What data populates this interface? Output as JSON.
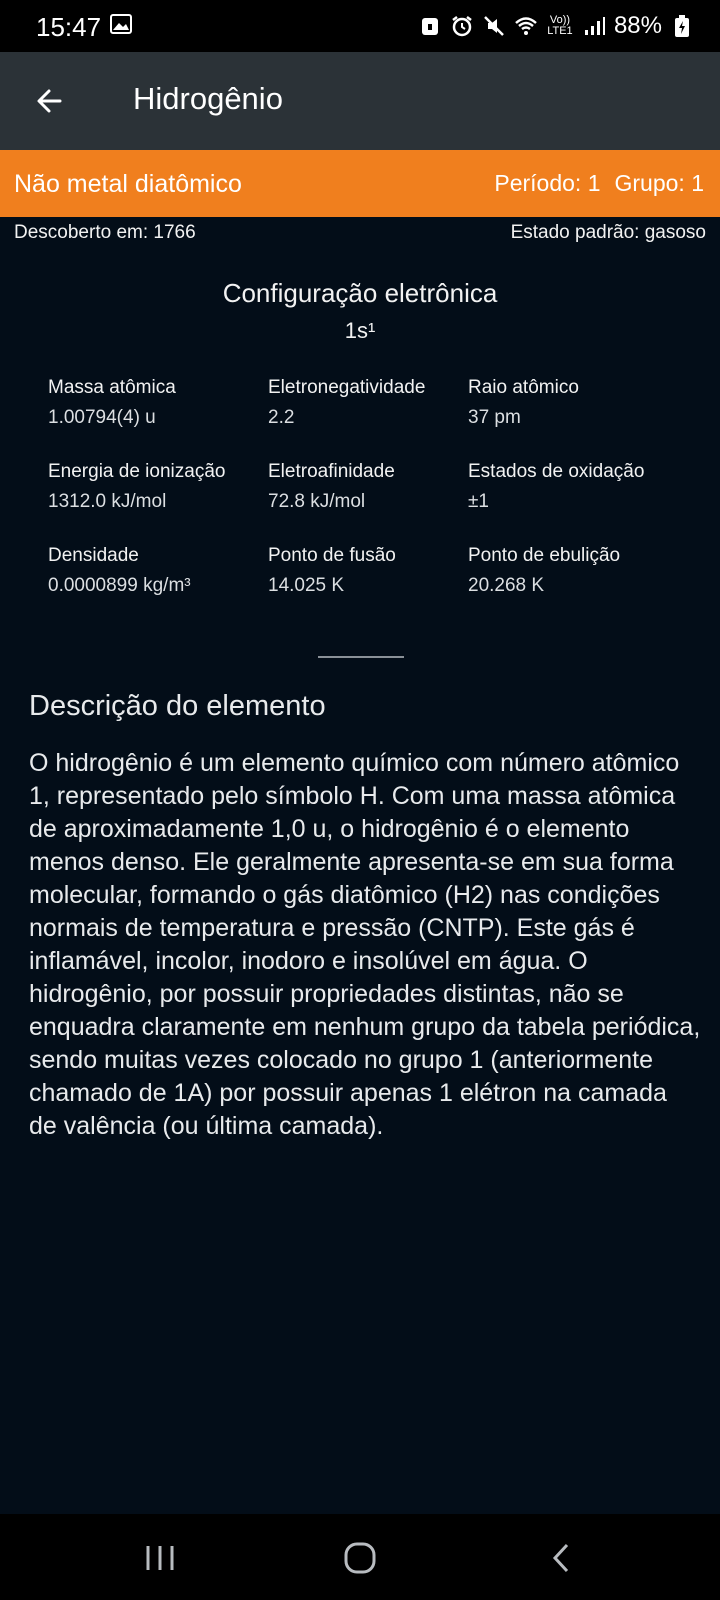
{
  "status_bar": {
    "time": "15:47",
    "network_label_top": "Vo))",
    "network_label_bottom": "LTE1",
    "battery": "88%"
  },
  "app_bar": {
    "title": "Hidrogênio",
    "back_icon": "arrow-left-icon"
  },
  "category_bar": {
    "name": "Não metal diatômico",
    "period": "Período: 1",
    "group": "Grupo: 1",
    "color": "#f07f1e"
  },
  "meta": {
    "discovered": "Descoberto em: 1766",
    "standard_state": "Estado padrão: gasoso"
  },
  "configuration": {
    "title": "Configuração eletrônica",
    "value": "1s¹"
  },
  "properties": [
    {
      "label": "Massa atômica",
      "value": "1.00794(4) u"
    },
    {
      "label": "Eletronegatividade",
      "value": "2.2"
    },
    {
      "label": "Raio atômico",
      "value": "37 pm"
    },
    {
      "label": "Energia de ionização",
      "value": "1312.0 kJ/mol"
    },
    {
      "label": "Eletroafinidade",
      "value": "72.8 kJ/mol"
    },
    {
      "label": "Estados de oxidação",
      "value": "±1"
    },
    {
      "label": "Densidade",
      "value": "0.0000899 kg/m³"
    },
    {
      "label": "Ponto de fusão",
      "value": "14.025 K"
    },
    {
      "label": "Ponto de ebulição",
      "value": "20.268 K"
    }
  ],
  "description": {
    "title": "Descrição do elemento",
    "text": "O hidrogênio é um elemento químico com número atômico 1, representado pelo símbolo H. Com uma massa atômica de aproximadamente 1,0 u, o hidrogênio é o elemento menos denso. Ele geralmente apresenta-se em sua forma molecular, formando o gás diatômico (H2) nas condições normais de temperatura e pressão (CNTP). Este gás é inflamável, incolor, inodoro e insolúvel em água. O hidrogênio, por possuir propriedades distintas, não se enquadra claramente em nenhum grupo da tabela periódica, sendo muitas vezes colocado no grupo 1 (anteriormente chamado de 1A) por possuir apenas 1 elétron na camada de valência (ou última camada)."
  },
  "nav_bar": {
    "icons": [
      "recents-icon",
      "home-icon",
      "back-icon"
    ]
  }
}
